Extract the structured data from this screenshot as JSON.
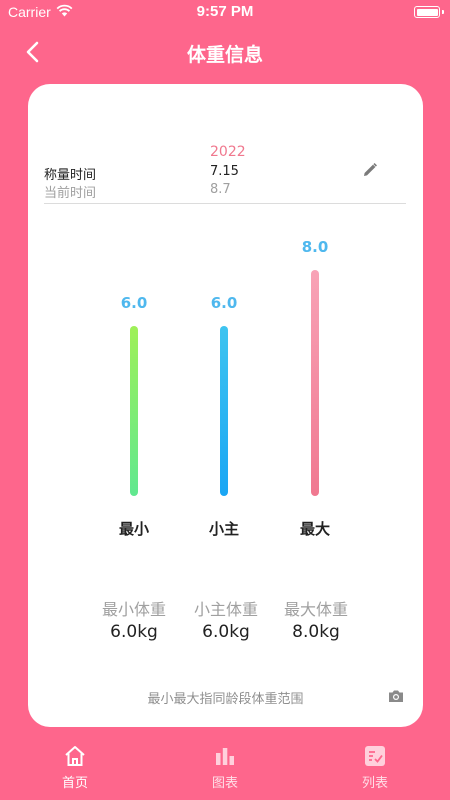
{
  "status": {
    "carrier": "Carrier",
    "time": "9:57 PM"
  },
  "nav": {
    "title": "体重信息"
  },
  "info": {
    "year": "2022",
    "weigh_label": "称量时间",
    "weigh_value": "7.15",
    "current_label": "当前时间",
    "current_value": "8.7"
  },
  "chart_data": {
    "type": "bar",
    "categories": [
      "最小",
      "小主",
      "最大"
    ],
    "values": [
      6.0,
      6.0,
      8.0
    ],
    "value_labels": [
      "6.0",
      "6.0",
      "8.0"
    ],
    "colors": [
      [
        "#60e890",
        "#9ff058"
      ],
      [
        "#1aa6f4",
        "#3ec4f0"
      ],
      [
        "#f07890",
        "#f8a3b6"
      ]
    ],
    "ylim": [
      0,
      8.0
    ]
  },
  "stats": [
    {
      "label": "最小体重",
      "value": "6.0kg"
    },
    {
      "label": "小主体重",
      "value": "6.0kg"
    },
    {
      "label": "最大体重",
      "value": "8.0kg"
    }
  ],
  "note": "最小最大指同龄段体重范围",
  "tabs": [
    {
      "label": "首页",
      "icon": "home-icon",
      "active": true
    },
    {
      "label": "图表",
      "icon": "chart-icon",
      "active": false
    },
    {
      "label": "列表",
      "icon": "list-icon",
      "active": false
    }
  ],
  "colors": {
    "background": "#fe668c",
    "value_blue": "#4fb8ee",
    "year_pink": "#f0788e"
  }
}
